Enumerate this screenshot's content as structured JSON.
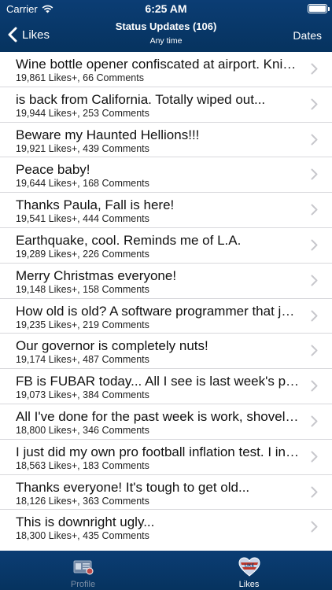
{
  "status_bar": {
    "carrier": "Carrier",
    "time": "6:25 AM",
    "battery_level": 1.0
  },
  "nav": {
    "back_label": "Likes",
    "title": "Status Updates (106)",
    "subtitle": "Any time",
    "right_label": "Dates"
  },
  "list": {
    "items": [
      {
        "title": "Wine bottle opener confiscated at airport. Knives and scissors too",
        "meta": "19,861 Likes+, 66 Comments"
      },
      {
        "title": "is back from California.  Totally wiped out...",
        "meta": "19,944 Likes+, 253 Comments"
      },
      {
        "title": "Beware my Haunted Hellions!!!",
        "meta": "19,921 Likes+, 439 Comments"
      },
      {
        "title": "Peace baby!",
        "meta": "19,644 Likes+, 168 Comments"
      },
      {
        "title": "Thanks Paula, Fall is here!",
        "meta": "19,541 Likes+, 444 Comments"
      },
      {
        "title": "Earthquake, cool. Reminds me of L.A.",
        "meta": "19,289 Likes+, 226 Comments"
      },
      {
        "title": "Merry Christmas everyone!",
        "meta": "19,148 Likes+, 158 Comments"
      },
      {
        "title": "How old is old?  A software programmer that just turned",
        "meta": "19,235 Likes+, 219 Comments"
      },
      {
        "title": "Our governor is completely nuts!",
        "meta": "19,174 Likes+, 487 Comments"
      },
      {
        "title": "FB is FUBAR today...  All I see is last week's posts",
        "meta": "19,073 Likes+, 384 Comments"
      },
      {
        "title": "All I've done for the past week is work, shovel snow and sleep",
        "meta": "18,800 Likes+, 346 Comments"
      },
      {
        "title": "I just did my own pro football inflation test.  I inflated",
        "meta": "18,563 Likes+, 183 Comments"
      },
      {
        "title": "Thanks everyone! It's tough to get old...",
        "meta": "18,126 Likes+, 363 Comments"
      },
      {
        "title": "This is downright ugly...",
        "meta": "18,300 Likes+, 435 Comments"
      }
    ]
  },
  "tabbar": {
    "profile_label": "Profile",
    "likes_label": "Likes",
    "selected": "Likes",
    "likes_badge": "LIKE"
  },
  "colors": {
    "bar_background": "#0b3d74",
    "chevron": "#c7c7cc",
    "separator": "#d8d8dc",
    "inactive_tab": "#7d8fa6"
  }
}
